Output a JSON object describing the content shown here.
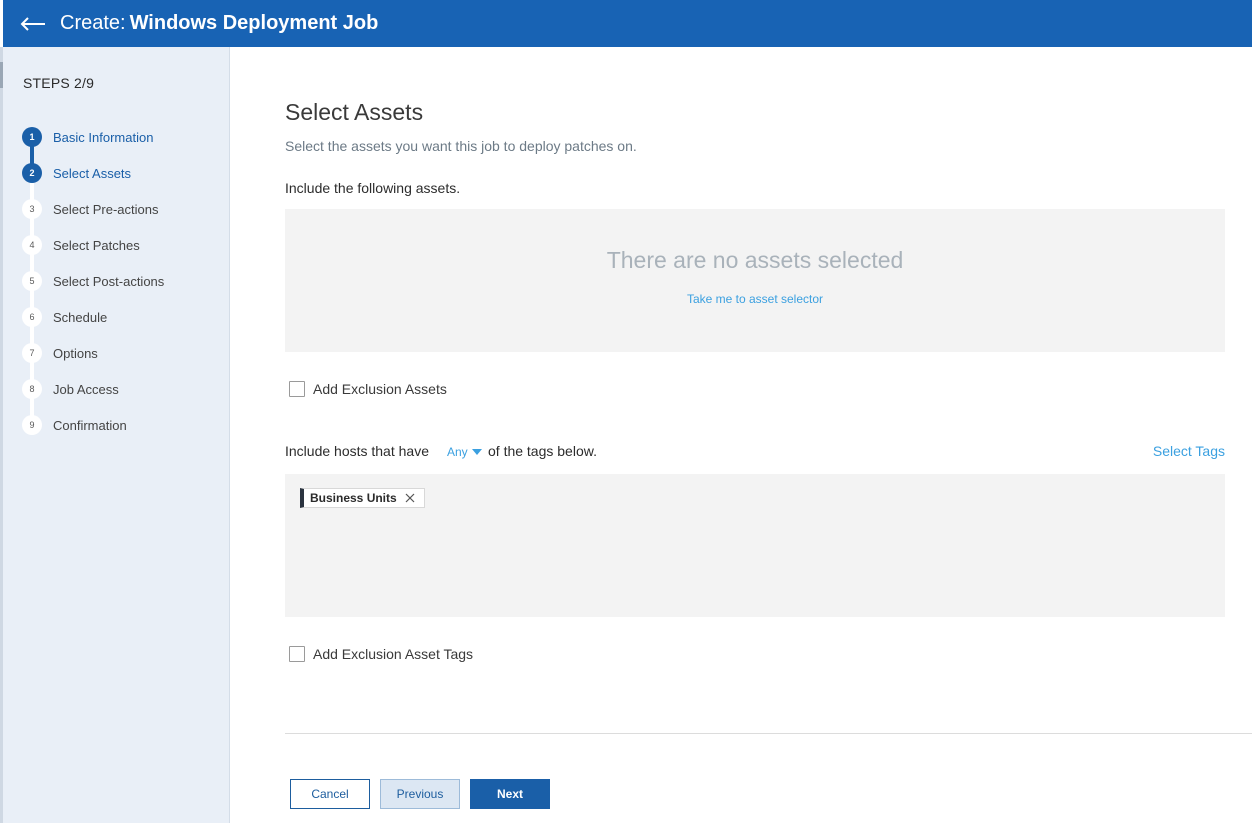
{
  "header": {
    "back_icon": "arrow-left-icon",
    "title_prefix": "Create:",
    "title_name": "Windows Deployment Job",
    "background": "#1863b4"
  },
  "sidebar": {
    "steps_label": "STEPS 2/9",
    "steps": [
      {
        "num": "1",
        "label": "Basic Information",
        "active": true
      },
      {
        "num": "2",
        "label": "Select Assets",
        "active": true
      },
      {
        "num": "3",
        "label": "Select Pre-actions",
        "active": false
      },
      {
        "num": "4",
        "label": "Select Patches",
        "active": false
      },
      {
        "num": "5",
        "label": "Select Post-actions",
        "active": false
      },
      {
        "num": "6",
        "label": "Schedule",
        "active": false
      },
      {
        "num": "7",
        "label": "Options",
        "active": false
      },
      {
        "num": "8",
        "label": "Job Access",
        "active": false
      },
      {
        "num": "9",
        "label": "Confirmation",
        "active": false
      }
    ]
  },
  "main": {
    "title": "Select Assets",
    "subtitle": "Select the assets you want this job to deploy patches on.",
    "include_label": "Include the following assets.",
    "assets_box": {
      "empty_text": "There are no assets selected",
      "link": "Take me to asset selector"
    },
    "exclusion_assets_label": "Add Exclusion Assets",
    "tags_row": {
      "prefix": "Include hosts that have",
      "dropdown_value": "Any",
      "suffix": "of the tags below.",
      "select_tags": "Select Tags"
    },
    "tags": [
      {
        "label": "Business Units"
      }
    ],
    "exclusion_tags_label": "Add Exclusion Asset Tags"
  },
  "footer": {
    "cancel": "Cancel",
    "previous": "Previous",
    "next": "Next"
  }
}
